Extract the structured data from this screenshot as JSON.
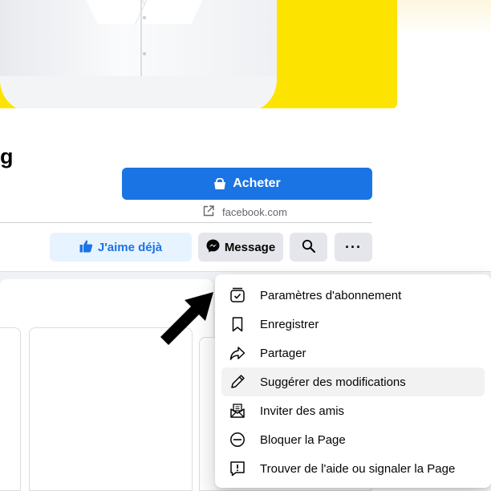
{
  "profile": {
    "name_tail": "g"
  },
  "buy_button": {
    "label": "Acheter",
    "icon": "shopping-bag-icon"
  },
  "website": {
    "text": "facebook.com",
    "icon": "external-link-icon"
  },
  "actions": {
    "like_label": "J'aime déjà",
    "message_label": "Message",
    "more_label": "···"
  },
  "colors": {
    "accent": "#1b74e4",
    "cover": "#fde400",
    "secondary_button": "#e4e6eb"
  },
  "menu": {
    "items": [
      {
        "label": "Paramètres d'abonnement",
        "icon": "subscription-settings-icon"
      },
      {
        "label": "Enregistrer",
        "icon": "bookmark-icon"
      },
      {
        "label": "Partager",
        "icon": "share-icon"
      },
      {
        "label": "Suggérer des modifications",
        "icon": "pencil-icon"
      },
      {
        "label": "Inviter des amis",
        "icon": "invite-envelope-icon"
      },
      {
        "label": "Bloquer la Page",
        "icon": "block-icon"
      },
      {
        "label": "Trouver de l'aide ou signaler la Page",
        "icon": "report-icon"
      }
    ]
  }
}
